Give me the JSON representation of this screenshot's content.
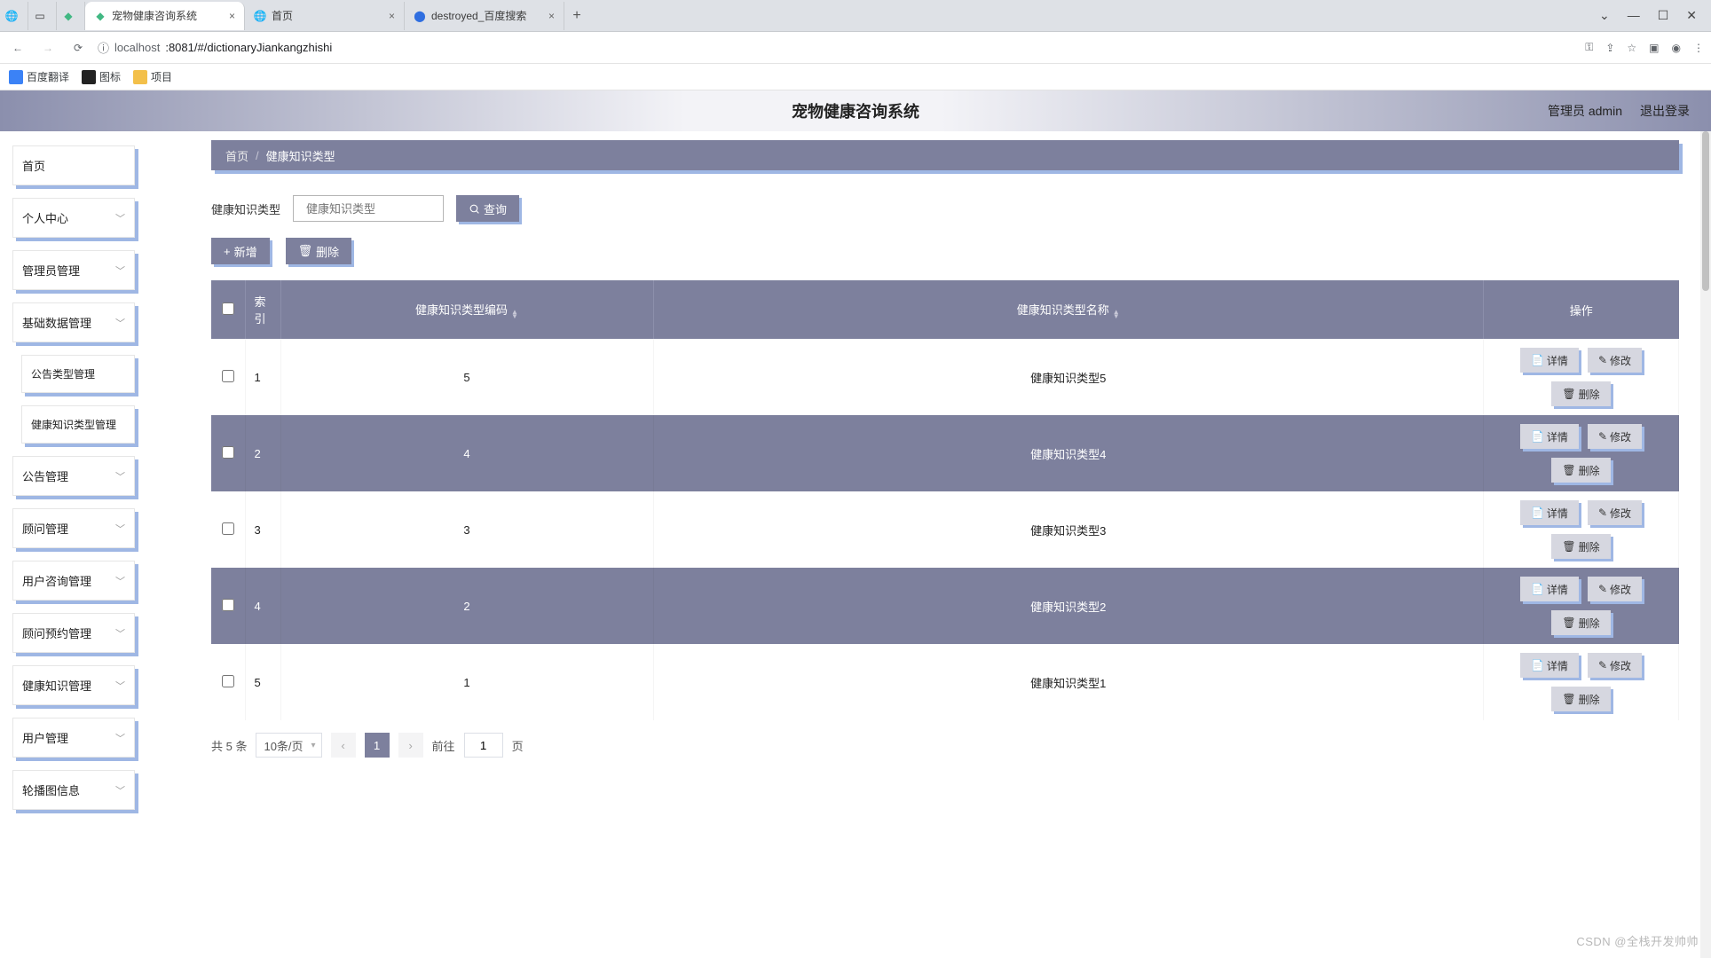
{
  "browser": {
    "tabs": [
      {
        "title": "",
        "favType": "globe"
      },
      {
        "title": "",
        "favType": "square"
      },
      {
        "title": "",
        "favType": "vue"
      },
      {
        "title": "宠物健康咨询系统",
        "favType": "vue",
        "active": true
      },
      {
        "title": "首页",
        "favType": "globe"
      },
      {
        "title": "destroyed_百度搜索",
        "favType": "baidu"
      }
    ],
    "url_info": "ⓘ",
    "url_host": "localhost",
    "url_port": ":8081/#/dictionaryJiankangzhishi",
    "bookmarks": [
      {
        "label": "百度翻译",
        "color": "#3b82f6"
      },
      {
        "label": "图标",
        "color": "#222"
      },
      {
        "label": "项目",
        "color": "#f3c04a"
      }
    ]
  },
  "header": {
    "title": "宠物健康咨询系统",
    "user": "管理员 admin",
    "logout": "退出登录"
  },
  "sidebar": {
    "items": [
      {
        "label": "首页",
        "expandable": false
      },
      {
        "label": "个人中心",
        "expandable": true
      },
      {
        "label": "管理员管理",
        "expandable": true
      },
      {
        "label": "基础数据管理",
        "expandable": true
      },
      {
        "label": "公告类型管理",
        "expandable": false,
        "sub": true
      },
      {
        "label": "健康知识类型管理",
        "expandable": false,
        "sub": true
      },
      {
        "label": "公告管理",
        "expandable": true
      },
      {
        "label": "顾问管理",
        "expandable": true
      },
      {
        "label": "用户咨询管理",
        "expandable": true
      },
      {
        "label": "顾问预约管理",
        "expandable": true
      },
      {
        "label": "健康知识管理",
        "expandable": true
      },
      {
        "label": "用户管理",
        "expandable": true
      },
      {
        "label": "轮播图信息",
        "expandable": true
      }
    ]
  },
  "breadcrumb": {
    "home": "首页",
    "sep": "/",
    "current": "健康知识类型"
  },
  "search": {
    "label": "健康知识类型",
    "placeholder": "健康知识类型",
    "queryBtn": "查询"
  },
  "toolbar": {
    "add": "新增",
    "del": "删除"
  },
  "table": {
    "headers": {
      "index": "索引",
      "code": "健康知识类型编码",
      "name": "健康知识类型名称",
      "op": "操作"
    },
    "opLabels": {
      "detail": "详情",
      "edit": "修改",
      "delete": "删除"
    },
    "rows": [
      {
        "index": "1",
        "code": "5",
        "name": "健康知识类型5"
      },
      {
        "index": "2",
        "code": "4",
        "name": "健康知识类型4"
      },
      {
        "index": "3",
        "code": "3",
        "name": "健康知识类型3"
      },
      {
        "index": "4",
        "code": "2",
        "name": "健康知识类型2"
      },
      {
        "index": "5",
        "code": "1",
        "name": "健康知识类型1"
      }
    ]
  },
  "pagination": {
    "total": "共 5 条",
    "pageSize": "10条/页",
    "page": "1",
    "goto": "前往",
    "gotoPage": "1",
    "pageSuffix": "页"
  },
  "watermark": "CSDN @全栈开发帅帅"
}
